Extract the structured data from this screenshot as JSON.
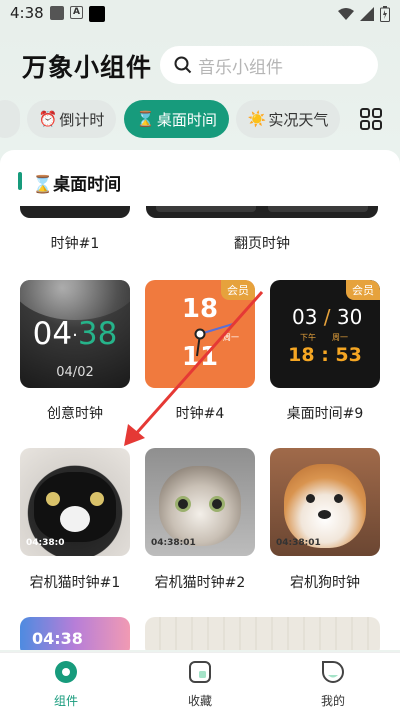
{
  "status_bar": {
    "time": "4:38",
    "a_icon": "A"
  },
  "header": {
    "app_title": "万象小组件",
    "search_placeholder": "音乐小组件"
  },
  "tabs": [
    {
      "icon": "⏰",
      "label": "倒计时"
    },
    {
      "icon": "⌛",
      "label": "桌面时间"
    },
    {
      "icon": "☀️",
      "label": "实况天气"
    }
  ],
  "section": {
    "title": "⌛桌面时间"
  },
  "widgets": [
    {
      "label": "时钟#1"
    },
    {
      "label": "翻页时钟"
    },
    {
      "label": "创意时钟",
      "hour": "04",
      "minute": "38",
      "date": "04/02"
    },
    {
      "label": "时钟#4",
      "top": "18",
      "bottom": "11",
      "week": "周一",
      "vip": "会员"
    },
    {
      "label": "桌面时间#9",
      "date": "03",
      "date2": "30",
      "ampm": "下午",
      "weekday": "周一",
      "time": "18 : 53",
      "vip": "会员"
    },
    {
      "label": "宕机猫时钟#1",
      "time": "04:38:0"
    },
    {
      "label": "宕机猫时钟#2",
      "time": "04:38:01"
    },
    {
      "label": "宕机狗时钟",
      "time": "04:38:01"
    },
    {
      "label": "",
      "time": "04:38"
    }
  ],
  "nav": [
    {
      "label": "组件",
      "active": true
    },
    {
      "label": "收藏"
    },
    {
      "label": "我的"
    }
  ],
  "colors": {
    "accent": "#179b7c",
    "vip": "#e6a23c",
    "arrow": "#e53935"
  }
}
